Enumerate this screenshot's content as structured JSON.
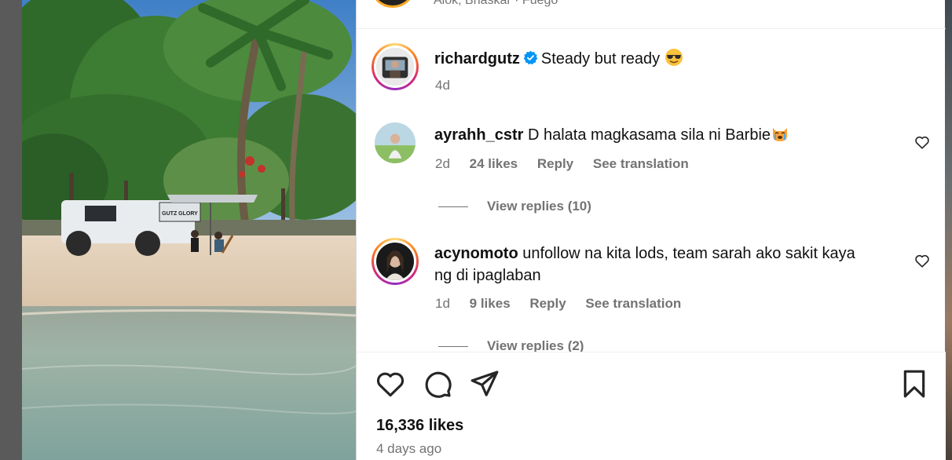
{
  "header": {
    "partial_text": "Alok, Bhaskar · Fuego"
  },
  "post": {
    "username": "richardgutz",
    "verified": true,
    "caption": "Steady but ready",
    "caption_emoji": "smiling-face-with-sunglasses",
    "age": "4d",
    "photo_sign_text": "GUTZ GLORY"
  },
  "comments": [
    {
      "username": "ayrahh_cstr",
      "text": "D halata magkasama sila ni Barbie",
      "emoji": "crying-cat",
      "age": "2d",
      "likes": "24 likes",
      "reply_label": "Reply",
      "translate_label": "See translation",
      "view_replies": "View replies (10)"
    },
    {
      "username": "acynomoto",
      "text_line1": "unfollow na kita lods, team sarah ako sakit kaya",
      "text_line2": "ng di ipaglaban",
      "age": "1d",
      "likes": "9 likes",
      "reply_label": "Reply",
      "translate_label": "See translation",
      "view_replies": "View replies (2)"
    }
  ],
  "actions": {
    "icons": [
      "heart-icon",
      "comment-icon",
      "share-icon",
      "bookmark-icon"
    ],
    "likes_count": "16,336 likes",
    "posted": "4 days ago"
  },
  "colors": {
    "verified_blue": "#0095f6",
    "secondary_text": "#737373",
    "story_ring": "#d62976"
  }
}
